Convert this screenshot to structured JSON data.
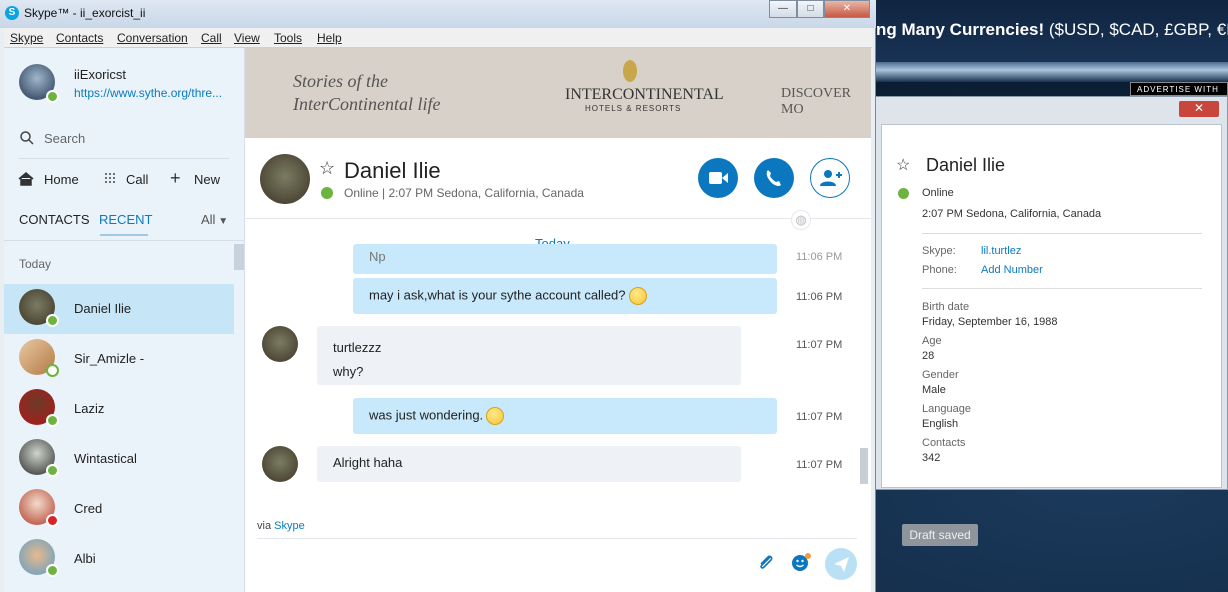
{
  "window": {
    "title": "Skype™ - ii_exorcist_ii",
    "min": "—",
    "max": "□",
    "close": "✕"
  },
  "menu": [
    "Skype",
    "Contacts",
    "Conversation",
    "Call",
    "View",
    "Tools",
    "Help"
  ],
  "profile": {
    "name": "iiExoricst",
    "mood": "https://www.sythe.org/thre..."
  },
  "search": {
    "placeholder": "Search"
  },
  "nav": {
    "home": "Home",
    "call": "Call",
    "new": "New"
  },
  "tabs": {
    "contacts": "CONTACTS",
    "recent": "RECENT",
    "filter": "All"
  },
  "section": "Today",
  "contacts": [
    {
      "name": "Daniel Ilie",
      "status": "on",
      "selected": true
    },
    {
      "name": "Sir_Amizle -",
      "status": "off"
    },
    {
      "name": "Laziz",
      "status": "on"
    },
    {
      "name": "Wintastical",
      "status": "on"
    },
    {
      "name": "Cred",
      "status": "dnd"
    },
    {
      "name": "Albi",
      "status": "on"
    }
  ],
  "ad": {
    "line1": "Stories of the",
    "line2": "InterContinental life",
    "brand": "INTERCONTINENTAL",
    "sub": "HOTELS & RESORTS",
    "cta": "DISCOVER MO"
  },
  "chat_header": {
    "name": "Daniel Ilie",
    "status": "Online | 2:07 PM Sedona, California, Canada"
  },
  "day_label": "Today",
  "messages": [
    {
      "from": "me",
      "text": "Np",
      "time": "11:06 PM"
    },
    {
      "from": "me",
      "text": "may i ask,what is your sythe account called?",
      "time": "11:06 PM"
    },
    {
      "from": "them",
      "text": "turtlezzz",
      "text2": "why?",
      "time": "11:07 PM"
    },
    {
      "from": "me",
      "text": "was just wondering.",
      "time": "11:07 PM"
    },
    {
      "from": "them",
      "text": "Alright haha",
      "time": "11:07 PM"
    }
  ],
  "via": {
    "prefix": "via ",
    "link": "Skype"
  },
  "banner": {
    "bold": "ng Many Currencies!",
    "rest": " ($USD, $CAD, £GBP, €E"
  },
  "advertise": "ADVERTISE WITH",
  "popup": {
    "name": "Daniel Ilie",
    "status": "Online",
    "location": "2:07 PM Sedona, California, Canada",
    "skype_label": "Skype:",
    "skype": "lil.turtlez",
    "phone_label": "Phone:",
    "phone": "Add Number",
    "birth_label": "Birth date",
    "birth": "Friday, September 16, 1988",
    "age_label": "Age",
    "age": "28",
    "gender_label": "Gender",
    "gender": "Male",
    "language_label": "Language",
    "language": "English",
    "contacts_label": "Contacts",
    "contacts": "342",
    "close": "✕"
  },
  "draft": "Draft saved",
  "colors": {
    "accent": "#0a77bf",
    "online": "#6cb33f",
    "dnd": "#d8232a",
    "selected": "#c6e6f7"
  }
}
